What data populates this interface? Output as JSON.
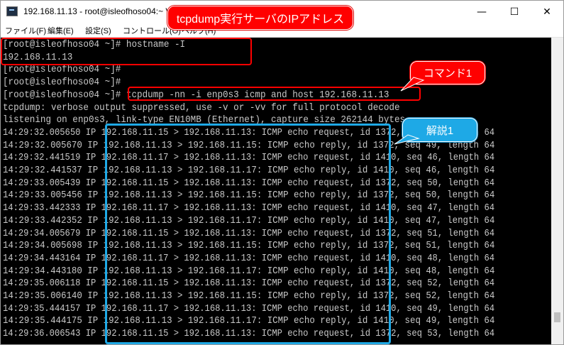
{
  "window": {
    "title": "192.168.11.13 - root@isleofhoso04:~ VT",
    "controls": {
      "minimize": "—",
      "maximize": "☐",
      "close": "✕"
    }
  },
  "menubar": {
    "items": [
      {
        "label": "ファイル(F)"
      },
      {
        "label": "編集(E)"
      },
      {
        "label": "設定(S)"
      },
      {
        "label": "コントロール(O)"
      },
      {
        "label": "ヘルプ(H)"
      }
    ]
  },
  "terminal": {
    "lines": [
      "[root@isleofhoso04 ~]# hostname -I",
      "192.168.11.13",
      "[root@isleofhoso04 ~]#",
      "[root@isleofhoso04 ~]#",
      "[root@isleofhoso04 ~]# tcpdump -nn -i enp0s3 icmp and host 192.168.11.13",
      "tcpdump: verbose output suppressed, use -v or -vv for full protocol decode",
      "listening on enp0s3, link-type EN10MB (Ethernet), capture size 262144 bytes",
      "14:29:32.005650 IP 192.168.11.15 > 192.168.11.13: ICMP echo request, id 1372, seq 49, length 64",
      "14:29:32.005670 IP 192.168.11.13 > 192.168.11.15: ICMP echo reply, id 1372, seq 49, length 64",
      "14:29:32.441519 IP 192.168.11.17 > 192.168.11.13: ICMP echo request, id 1410, seq 46, length 64",
      "14:29:32.441537 IP 192.168.11.13 > 192.168.11.17: ICMP echo reply, id 1410, seq 46, length 64",
      "14:29:33.005439 IP 192.168.11.15 > 192.168.11.13: ICMP echo request, id 1372, seq 50, length 64",
      "14:29:33.005456 IP 192.168.11.13 > 192.168.11.15: ICMP echo reply, id 1372, seq 50, length 64",
      "14:29:33.442333 IP 192.168.11.17 > 192.168.11.13: ICMP echo request, id 1410, seq 47, length 64",
      "14:29:33.442352 IP 192.168.11.13 > 192.168.11.17: ICMP echo reply, id 1410, seq 47, length 64",
      "14:29:34.005679 IP 192.168.11.15 > 192.168.11.13: ICMP echo request, id 1372, seq 51, length 64",
      "14:29:34.005698 IP 192.168.11.13 > 192.168.11.15: ICMP echo reply, id 1372, seq 51, length 64",
      "14:29:34.443164 IP 192.168.11.17 > 192.168.11.13: ICMP echo request, id 1410, seq 48, length 64",
      "14:29:34.443180 IP 192.168.11.13 > 192.168.11.17: ICMP echo reply, id 1410, seq 48, length 64",
      "14:29:35.006118 IP 192.168.11.15 > 192.168.11.13: ICMP echo request, id 1372, seq 52, length 64",
      "14:29:35.006140 IP 192.168.11.13 > 192.168.11.15: ICMP echo reply, id 1372, seq 52, length 64",
      "14:29:35.444157 IP 192.168.11.17 > 192.168.11.13: ICMP echo request, id 1410, seq 49, length 64",
      "14:29:35.444175 IP 192.168.11.13 > 192.168.11.17: ICMP echo reply, id 1410, seq 49, length 64",
      "14:29:36.006543 IP 192.168.11.15 > 192.168.11.13: ICMP echo request, id 1372, seq 53, length 64"
    ]
  },
  "annotations": {
    "ip_callout": "tcpdump実行サーバのIPアドレス",
    "command_callout": "コマンド1",
    "explanation_callout": "解説1"
  },
  "colors": {
    "terminal_bg": "#000000",
    "terminal_fg": "#c8c8c8",
    "annotation_red": "#ff0000",
    "annotation_blue": "#1ea9e6"
  }
}
